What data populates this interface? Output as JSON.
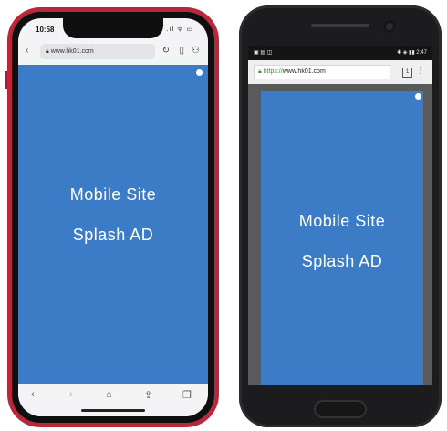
{
  "iphone": {
    "time": "10:58",
    "status_icons": ".ıl ᯤ ▭",
    "url": "www.hk01.com",
    "ad_line1": "Mobile Site",
    "ad_line2": "Splash AD",
    "colors": {
      "frame": "#b8283a",
      "content": "#3c7cc6"
    }
  },
  "android": {
    "status_left": "▣ ▤ ◫",
    "status_right": "✱ ◈ ▮▮ 2:47",
    "url_scheme": "https://",
    "url_host": "www.hk01.com",
    "tabs_count": "1",
    "ad_line1": "Mobile Site",
    "ad_line2": "Splash AD",
    "colors": {
      "frame": "#1c1c1e",
      "content": "#3c7cc6",
      "secure": "#2a9d3e"
    }
  }
}
